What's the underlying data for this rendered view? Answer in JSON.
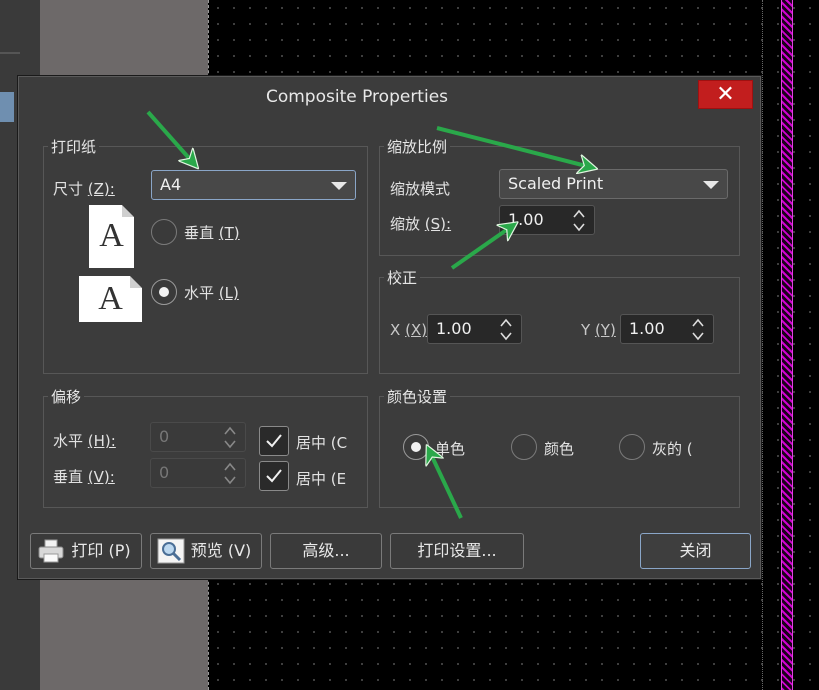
{
  "dialog": {
    "title": "Composite Properties",
    "close_glyph": "✕"
  },
  "paper": {
    "group_label": "打印纸",
    "size_label": "尺寸",
    "size_key": "(Z):",
    "size_key_letter": "Z",
    "size_value": "A4",
    "portrait_label": "垂直",
    "portrait_key": "(T)",
    "landscape_label": "水平",
    "landscape_key": "(L)",
    "orientation_selected": "landscape",
    "page_letter": "A"
  },
  "scale": {
    "group_label": "缩放比例",
    "mode_label": "缩放模式",
    "mode_value": "Scaled Print",
    "scale_label": "缩放",
    "scale_key": "(S):",
    "scale_value": "1.00"
  },
  "correction": {
    "group_label": "校正",
    "x_label": "X",
    "x_key": "(X)",
    "x_value": "1.00",
    "y_label": "Y",
    "y_key": "(Y)",
    "y_value": "1.00"
  },
  "offset": {
    "group_label": "偏移",
    "h_label": "水平",
    "h_key": "(H):",
    "h_value": "0",
    "v_label": "垂直",
    "v_key": "(V):",
    "v_value": "0",
    "center_h_label": "居中 (C",
    "center_v_label": "居中 (E",
    "center_h_checked": true,
    "center_v_checked": true
  },
  "color": {
    "group_label": "颜色设置",
    "mono_label": "单色",
    "color_label": "颜色",
    "gray_label": "灰的 (",
    "selected": "mono"
  },
  "buttons": {
    "print": "打印 (P)",
    "preview": "预览 (V)",
    "advanced": "高级...",
    "print_setup": "打印设置...",
    "close": "关闭"
  },
  "colors": {
    "annotation_arrow": "#2aa84a",
    "close_button": "#c21e1e",
    "focus_border": "#8aa6c8"
  }
}
